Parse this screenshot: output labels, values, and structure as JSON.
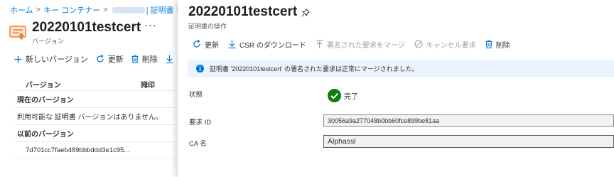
{
  "breadcrumb": {
    "home": "ホーム",
    "sep": ">",
    "keyvault": "キー コンテナー",
    "certs": "| 証明書"
  },
  "left_blade": {
    "title": "20220101testcert",
    "ellipsis": "···",
    "subtitle": "バージョン",
    "toolbar": {
      "new_version": "新しいバージョン",
      "refresh": "更新",
      "delete": "削除",
      "download": "ダ"
    },
    "table": {
      "headers": [
        "バージョン",
        "拇印"
      ],
      "current_group": "現在のバージョン",
      "no_current": "利用可能な 証明書 バージョンはありません。",
      "previous_group": "以前のバージョン",
      "previous_ids": [
        "7d701cc7faeb489bbbddd3e1c95..."
      ]
    }
  },
  "blade": {
    "title": "20220101testcert",
    "subtitle": "証明書の操作",
    "toolbar": {
      "refresh": "更新",
      "download_csr": "CSR のダウンロード",
      "merge_signed": "署名された要求をマージ",
      "cancel_request": "キャンセル要求",
      "delete": "削除"
    },
    "info_message": "証明書 '20220101testcert' の署名された要求は正常にマージされました。",
    "fields": {
      "status_label": "状態",
      "status_value": "完了",
      "request_id_label": "要求 ID",
      "request_id_value": "30056a9a277048b0bb60fce899be81aa",
      "ca_label": "CA 名",
      "ca_value": "Alphassl"
    }
  },
  "colors": {
    "accent": "#0078d4",
    "success": "#107c10",
    "info_bg": "#ebf3fc",
    "cert_icon": "#e8833a"
  }
}
